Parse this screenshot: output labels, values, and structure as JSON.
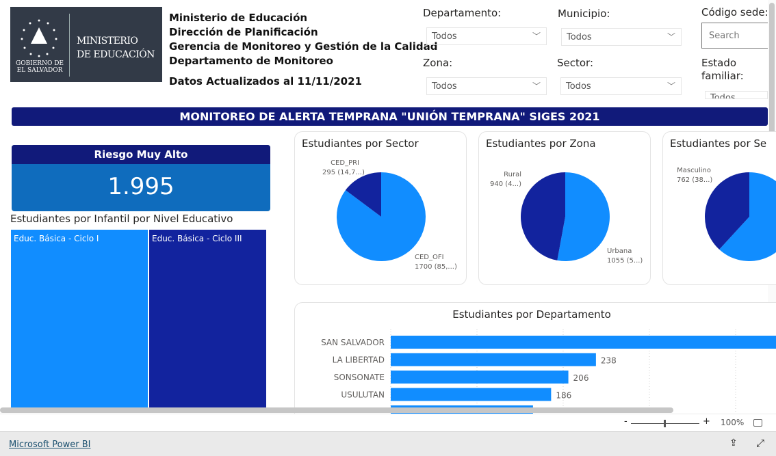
{
  "logo": {
    "line1": "MINISTERIO",
    "line2": "DE EDUCACIÓN",
    "gov1": "GOBIERNO DE",
    "gov2": "EL SALVADOR"
  },
  "header": {
    "lines": [
      "Ministerio de Educación",
      "Dirección de Planificación",
      "Gerencia de Monitoreo y Gestión de la Calidad",
      "Departamento de Monitoreo"
    ],
    "updated": "Datos Actualizados al 11/11/2021"
  },
  "filters": {
    "departamento": {
      "label": "Departamento:",
      "value": "Todos"
    },
    "municipio": {
      "label": "Municipio:",
      "value": "Todos"
    },
    "zona": {
      "label": "Zona:",
      "value": "Todos"
    },
    "sector": {
      "label": "Sector:",
      "value": "Todos"
    },
    "codigo_sede": {
      "label": "Código sede:",
      "placeholder": "Search"
    },
    "estado_familiar": {
      "label": "Estado familiar:",
      "value": "Todos"
    }
  },
  "banner": "MONITOREO DE ALERTA TEMPRANA \"UNIÓN TEMPRANA\" SIGES 2021",
  "kpi": {
    "title": "Riesgo Muy Alto",
    "value": "1.995"
  },
  "treemap": {
    "title": "Estudiantes por Infantil por Nivel Educativo",
    "items": [
      {
        "label": "Educ. Básica - Ciclo I",
        "color": "#118dff"
      },
      {
        "label": "Educ. Básica - Ciclo III",
        "color": "#12239e"
      }
    ]
  },
  "chart_data": [
    {
      "type": "pie",
      "title": "Estudiantes por Sector",
      "slices": [
        {
          "name": "CED_OFI",
          "value": 1700,
          "label": "1700 (85,...)",
          "color": "#118dff"
        },
        {
          "name": "CED_PRI",
          "value": 295,
          "label": "295 (14,7...)",
          "color": "#12239e"
        }
      ]
    },
    {
      "type": "pie",
      "title": "Estudiantes por Zona",
      "slices": [
        {
          "name": "Urbana",
          "value": 1055,
          "label": "1055 (5...)",
          "color": "#118dff"
        },
        {
          "name": "Rural",
          "value": 940,
          "label": "940 (4...)",
          "color": "#12239e"
        }
      ]
    },
    {
      "type": "pie",
      "title": "Estudiantes por Se",
      "slices": [
        {
          "name": "",
          "value": 1233,
          "label": "",
          "color": "#118dff"
        },
        {
          "name": "Masculino",
          "value": 762,
          "label": "762 (38...)",
          "color": "#12239e"
        }
      ]
    },
    {
      "type": "bar",
      "orientation": "horizontal",
      "title": "Estudiantes por Departamento",
      "grid": true,
      "xlim": [
        0,
        440
      ],
      "categories": [
        "SAN SALVADOR",
        "LA LIBERTAD",
        "SONSONATE",
        "USULUTAN",
        ""
      ],
      "values": [
        460,
        238,
        206,
        186,
        165
      ],
      "labels": [
        "",
        "238",
        "206",
        "186",
        ""
      ],
      "color": "#118dff"
    }
  ],
  "zoom": {
    "minus": "-",
    "plus": "+",
    "value": "100%"
  },
  "footer": {
    "brand": "Microsoft Power BI"
  }
}
